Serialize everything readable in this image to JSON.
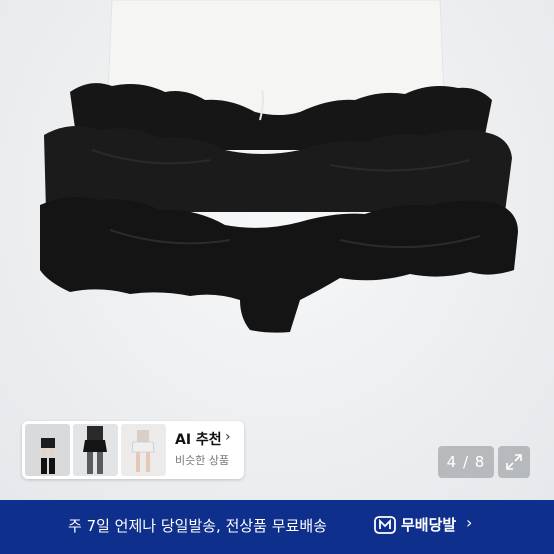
{
  "gallery": {
    "page_counter": "4 / 8"
  },
  "ai_recommend": {
    "title": "AI 추천",
    "chevron": "›",
    "subtitle": "비슷한 상품"
  },
  "promo": {
    "text": "주 7일 언제나 당일발송, 전상품 무료배송",
    "badge_label": "무배당발",
    "chevron": "›",
    "background_color": "#0e2f8c"
  },
  "icons": {
    "expand": "expand-icon",
    "badge": "delivery-badge-icon"
  }
}
